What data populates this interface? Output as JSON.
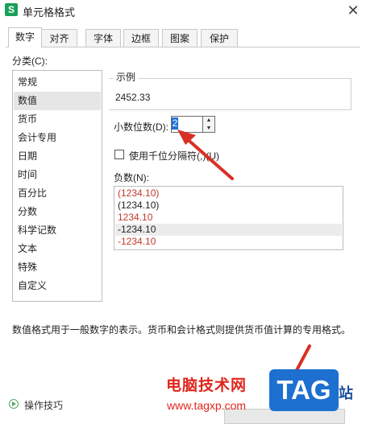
{
  "window": {
    "title": "单元格格式",
    "icon_letter": "S",
    "close_glyph": "✕"
  },
  "tabs": [
    {
      "label": "数字"
    },
    {
      "label": "对齐"
    },
    {
      "label": "字体"
    },
    {
      "label": "边框"
    },
    {
      "label": "图案"
    },
    {
      "label": "保护"
    }
  ],
  "category": {
    "label": "分类(C):",
    "items": [
      "常规",
      "数值",
      "货币",
      "会计专用",
      "日期",
      "时间",
      "百分比",
      "分数",
      "科学记数",
      "文本",
      "特殊",
      "自定义"
    ],
    "selected": "数值"
  },
  "sample": {
    "label": "示例",
    "value": "2452.33"
  },
  "decimals": {
    "label": "小数位数(D):",
    "value": "2"
  },
  "thousands": {
    "label": "使用千位分隔符(,)(U)",
    "checked": false
  },
  "negative": {
    "label": "负数(N):",
    "items": [
      {
        "text": "(1234.10)",
        "color": "#c0392b"
      },
      {
        "text": "(1234.10)",
        "color": "#222222"
      },
      {
        "text": "1234.10",
        "color": "#c0392b"
      },
      {
        "text": "-1234.10",
        "color": "#222222"
      },
      {
        "text": "-1234.10",
        "color": "#c0392b"
      }
    ],
    "selected_index": 3
  },
  "description": "数值格式用于一般数字的表示。货币和会计格式则提供货币值计算的专用格式。",
  "footer": {
    "tips_label": "操作技巧"
  },
  "watermark": {
    "title": "电脑技术网",
    "url": "www.tagxp.com",
    "logo": "TAG",
    "side_text": "站"
  },
  "colors": {
    "selected_value_bg": "#1f6fd2",
    "arrow": "#d93025",
    "negative_red": "#c0392b"
  }
}
